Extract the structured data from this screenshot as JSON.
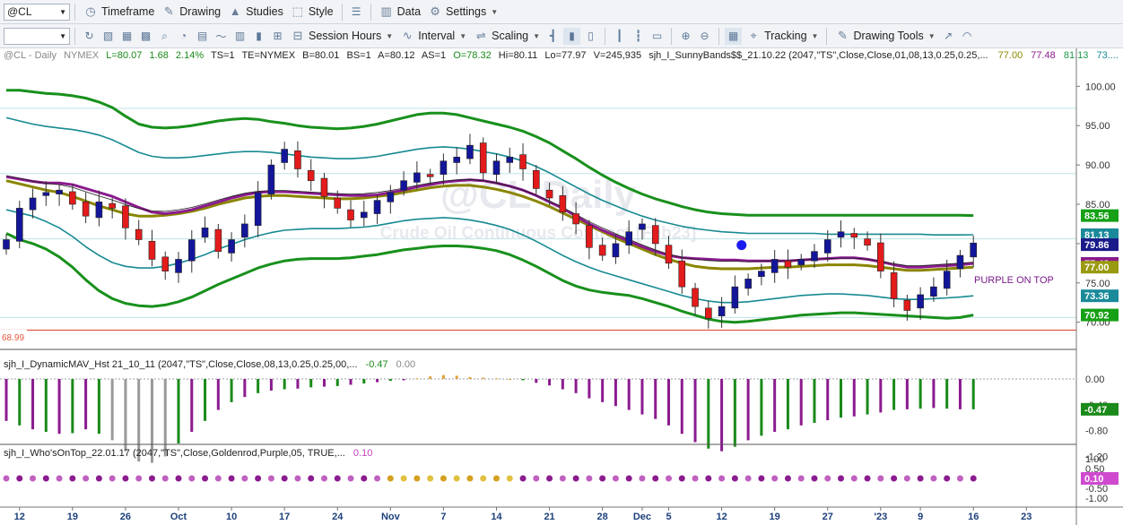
{
  "toolbar1": {
    "symbol": "@CL",
    "items": [
      {
        "label": "Timeframe",
        "icon": "timeframe-icon"
      },
      {
        "label": "Drawing",
        "icon": "pencil-icon"
      },
      {
        "label": "Studies",
        "icon": "studies-icon"
      },
      {
        "label": "Style",
        "icon": "style-icon"
      },
      {
        "label": "Data",
        "icon": "data-icon"
      },
      {
        "label": "Settings",
        "icon": "gear-icon"
      }
    ]
  },
  "toolbar2": {
    "input_value": "",
    "items": [
      {
        "label": "Session Hours"
      },
      {
        "label": "Interval"
      },
      {
        "label": "Scaling"
      },
      {
        "label": "Tracking"
      },
      {
        "label": "Drawing Tools"
      }
    ]
  },
  "header": {
    "prefix": "@CL - Daily",
    "exchange": "NYMEX",
    "last": "L=80.07",
    "change": "1.68",
    "pct": "2.14%",
    "ts": "TS=1",
    "te": "TE=NYMEX",
    "bid": "B=80.01",
    "bs": "BS=1",
    "ask": "A=80.12",
    "as": "AS=1",
    "open": "O=78.32",
    "high": "Hi=80.11",
    "low": "Lo=77.97",
    "volume": "V=245,935",
    "study": "sjh_I_SunnyBands$$_21.10.22 (2047,\"TS\",Close,Close,01,08,13,0.25,0.25,...",
    "values": [
      {
        "text": "77.00",
        "color": "#8a8a00"
      },
      {
        "text": "77.48",
        "color": "#8a1a8a"
      },
      {
        "text": "81.13",
        "color": "#1a9a4a"
      },
      {
        "text": "73....",
        "color": "#1a8a9a"
      }
    ]
  },
  "watermark": {
    "title": "@CL Daily",
    "subtitle": "Crude Oil Continuous Contract [Feb23]"
  },
  "annotation": {
    "text": "PURPLE ON TOP",
    "color": "#7a1a8a"
  },
  "price_line": {
    "value": 68.99,
    "label": "68.99",
    "color": "#e2593f"
  },
  "h_lines": [
    97.2,
    88.9,
    80.6,
    70.6
  ],
  "dot": {
    "x": 55.5,
    "y": 79.8,
    "color": "#1b1bf0"
  },
  "panel2": {
    "title": "sjh_I_DynamicMAV_Hst 21_10_11 (2047,\"TS\",Close,Close,08,13,0.25,0.25,00,...",
    "values": [
      {
        "text": "-0.47",
        "color": "#1a8a1a"
      },
      {
        "text": "0.00",
        "color": "#888888"
      }
    ],
    "ticks": [
      "0.00",
      "-0.40",
      "-0.80",
      "-1.20"
    ],
    "last_label": "-0.47"
  },
  "panel3": {
    "title": "sjh_I_Who'sOnTop_22.01.17 (2047,\"TS\",Close,Goldenrod,Purple,05, TRUE,...",
    "value": {
      "text": "0.10",
      "color": "#c23fbf"
    },
    "ticks": [
      "1.00",
      "0.50",
      "-0.50",
      "-1.00"
    ],
    "last_label": "0.10"
  },
  "chart_data": {
    "type": "candlestick",
    "ylim": [
      67,
      103
    ],
    "y_ticks": [
      100,
      95,
      90,
      85,
      80,
      75,
      70
    ],
    "x_ticks": [
      {
        "i": 1,
        "label": "12"
      },
      {
        "i": 5,
        "label": "19"
      },
      {
        "i": 9,
        "label": "26"
      },
      {
        "i": 13,
        "label": "Oct"
      },
      {
        "i": 17,
        "label": "10"
      },
      {
        "i": 21,
        "label": "17"
      },
      {
        "i": 25,
        "label": "24"
      },
      {
        "i": 29,
        "label": "Nov"
      },
      {
        "i": 33,
        "label": "7"
      },
      {
        "i": 37,
        "label": "14"
      },
      {
        "i": 41,
        "label": "21"
      },
      {
        "i": 45,
        "label": "28"
      },
      {
        "i": 48,
        "label": "Dec"
      },
      {
        "i": 50,
        "label": "5"
      },
      {
        "i": 54,
        "label": "12"
      },
      {
        "i": 58,
        "label": "19"
      },
      {
        "i": 62,
        "label": "27"
      },
      {
        "i": 66,
        "label": "'23"
      },
      {
        "i": 69,
        "label": "9"
      },
      {
        "i": 73,
        "label": "16"
      },
      {
        "i": 77,
        "label": "23"
      }
    ],
    "right_labels": [
      {
        "v": 83.56,
        "text": "83.56",
        "color": "#15a015"
      },
      {
        "v": 81.13,
        "text": "81.13",
        "color": "#1a8a9a"
      },
      {
        "v": 79.86,
        "text": "79.86",
        "color": "#1a1a8a"
      },
      {
        "v": 77.48,
        "text": "77.48",
        "color": "#8a1a8a"
      },
      {
        "v": 77.0,
        "text": "77.00",
        "color": "#9a9a10"
      },
      {
        "v": 73.36,
        "text": "73.36",
        "color": "#1a8a9a"
      },
      {
        "v": 70.92,
        "text": "70.92",
        "color": "#15a015"
      }
    ],
    "closes": [
      80.5,
      84.5,
      85.8,
      86.5,
      86.8,
      85.0,
      83.5,
      85.3,
      84.5,
      82.0,
      80.5,
      78.0,
      76.5,
      78.0,
      80.5,
      82.0,
      79.0,
      80.5,
      82.5,
      86.5,
      90.0,
      92.0,
      89.5,
      88.0,
      86.0,
      84.5,
      83.0,
      84.0,
      85.5,
      86.5,
      88.0,
      89.0,
      88.5,
      90.5,
      91.0,
      92.5,
      89.0,
      90.5,
      91.0,
      89.5,
      87.0,
      85.8,
      84.0,
      82.5,
      79.5,
      78.5,
      80.0,
      81.5,
      82.5,
      80.0,
      77.5,
      74.5,
      72.0,
      70.5,
      72.0,
      74.5,
      75.5,
      76.5,
      78.0,
      77.0,
      78.0,
      79.0,
      80.5,
      81.5,
      80.8,
      79.8,
      76.5,
      73.0,
      71.5,
      73.5,
      74.5,
      76.5,
      78.5,
      80.07
    ],
    "ma_purple": [
      88.5,
      88.2,
      87.9,
      87.7,
      87.7,
      87.5,
      87.0,
      86.5,
      86.0,
      85.3,
      84.6,
      84.0,
      83.8,
      84.0,
      84.3,
      84.8,
      85.3,
      85.8,
      86.2,
      86.5,
      86.6,
      86.6,
      86.5,
      86.4,
      86.3,
      86.2,
      86.1,
      86.1,
      86.2,
      86.5,
      86.8,
      87.2,
      87.5,
      87.8,
      88.0,
      88.1,
      88.0,
      87.7,
      87.3,
      86.8,
      86.1,
      85.3,
      84.5,
      83.5,
      82.5,
      81.7,
      81.0,
      80.3,
      79.6,
      79.0,
      78.5,
      78.2,
      78.1,
      78.0,
      77.9,
      77.9,
      77.8,
      77.8,
      77.8,
      77.8,
      77.9,
      78.0,
      78.1,
      78.2,
      78.2,
      78.0,
      77.7,
      77.3,
      77.0,
      77.0,
      77.1,
      77.2,
      77.3,
      77.48
    ],
    "ma_olive": [
      88.0,
      87.6,
      87.2,
      86.8,
      86.5,
      86.0,
      85.4,
      84.8,
      84.3,
      83.8,
      83.5,
      83.5,
      83.6,
      83.8,
      84.1,
      84.5,
      85.0,
      85.4,
      85.8,
      86.0,
      86.1,
      86.1,
      86.0,
      85.9,
      85.8,
      85.7,
      85.7,
      85.8,
      86.0,
      86.2,
      86.5,
      86.8,
      87.1,
      87.3,
      87.4,
      87.4,
      87.2,
      86.9,
      86.5,
      86.0,
      85.4,
      84.7,
      83.9,
      83.1,
      82.3,
      81.5,
      80.7,
      80.0,
      79.3,
      78.6,
      78.0,
      77.5,
      77.1,
      76.9,
      76.8,
      76.8,
      76.8,
      76.9,
      77.0,
      77.0,
      77.1,
      77.2,
      77.3,
      77.3,
      77.3,
      77.2,
      77.0,
      76.8,
      76.6,
      76.6,
      76.7,
      76.8,
      76.9,
      77.0
    ],
    "band_outer_up": [
      99.5,
      99.5,
      99.3,
      99.1,
      99.0,
      98.8,
      98.5,
      98.0,
      97.3,
      96.2,
      95.2,
      94.8,
      94.7,
      94.8,
      95.0,
      95.3,
      95.6,
      95.8,
      95.9,
      95.8,
      95.5,
      95.3,
      95.0,
      94.8,
      94.7,
      94.6,
      94.7,
      94.9,
      95.2,
      95.6,
      96.0,
      96.4,
      96.6,
      96.6,
      96.4,
      96.0,
      95.6,
      95.2,
      94.8,
      94.3,
      93.6,
      92.8,
      91.8,
      90.8,
      89.7,
      88.7,
      87.8,
      87.0,
      86.3,
      85.7,
      85.2,
      84.7,
      84.3,
      84.0,
      83.8,
      83.7,
      83.6,
      83.6,
      83.6,
      83.6,
      83.6,
      83.6,
      83.6,
      83.6,
      83.6,
      83.6,
      83.6,
      83.6,
      83.6,
      83.6,
      83.6,
      83.6,
      83.6,
      83.56
    ],
    "band_outer_lo": [
      81.3,
      80.5,
      80.0,
      79.3,
      78.3,
      77.0,
      75.4,
      74.0,
      73.0,
      72.4,
      72.1,
      72.0,
      72.2,
      72.6,
      73.2,
      74.0,
      74.8,
      75.5,
      76.2,
      76.9,
      77.4,
      77.8,
      78.0,
      78.1,
      78.1,
      78.1,
      78.2,
      78.4,
      78.6,
      78.9,
      79.2,
      79.4,
      79.6,
      79.7,
      79.7,
      79.6,
      79.4,
      79.1,
      78.6,
      77.9,
      77.1,
      76.2,
      75.3,
      74.6,
      74.1,
      73.8,
      73.6,
      73.4,
      73.0,
      72.5,
      72.0,
      71.4,
      70.9,
      70.4,
      70.1,
      70.0,
      70.1,
      70.3,
      70.5,
      70.7,
      70.9,
      71.0,
      71.1,
      71.2,
      71.2,
      71.1,
      71.0,
      70.9,
      70.8,
      70.7,
      70.6,
      70.5,
      70.6,
      70.92
    ],
    "band_inner_up": [
      96.0,
      95.6,
      95.2,
      94.9,
      94.7,
      94.5,
      94.2,
      93.8,
      93.2,
      92.4,
      91.6,
      91.1,
      90.9,
      90.9,
      91.0,
      91.2,
      91.4,
      91.6,
      91.7,
      91.7,
      91.6,
      91.4,
      91.2,
      91.0,
      90.9,
      90.8,
      90.8,
      90.9,
      91.1,
      91.4,
      91.7,
      92.0,
      92.2,
      92.3,
      92.2,
      92.0,
      91.7,
      91.4,
      91.0,
      90.5,
      89.8,
      89.0,
      88.1,
      87.2,
      86.3,
      85.5,
      84.8,
      84.1,
      83.5,
      83.0,
      82.6,
      82.2,
      81.9,
      81.7,
      81.5,
      81.4,
      81.3,
      81.3,
      81.3,
      81.3,
      81.3,
      81.3,
      81.2,
      81.2,
      81.2,
      81.2,
      81.2,
      81.2,
      81.2,
      81.2,
      81.1,
      81.1,
      81.1,
      81.13
    ],
    "band_inner_lo": [
      84.3,
      83.9,
      83.5,
      82.8,
      82.0,
      80.9,
      79.6,
      78.5,
      77.6,
      77.1,
      76.9,
      76.9,
      77.1,
      77.5,
      78.0,
      78.6,
      79.3,
      79.9,
      80.5,
      81.0,
      81.4,
      81.7,
      81.8,
      81.9,
      81.9,
      81.9,
      82.0,
      82.1,
      82.3,
      82.6,
      82.9,
      83.1,
      83.2,
      83.3,
      83.2,
      83.0,
      82.7,
      82.3,
      81.8,
      81.1,
      80.3,
      79.4,
      78.5,
      77.7,
      77.0,
      76.4,
      75.9,
      75.4,
      74.9,
      74.4,
      73.9,
      73.4,
      73.0,
      72.7,
      72.5,
      72.5,
      72.6,
      72.8,
      73.0,
      73.2,
      73.4,
      73.5,
      73.6,
      73.6,
      73.5,
      73.4,
      73.2,
      73.0,
      72.9,
      72.9,
      73.0,
      73.1,
      73.2,
      73.36
    ],
    "histogram": [
      -0.65,
      -0.72,
      -0.78,
      -0.82,
      -0.85,
      -0.84,
      -0.78,
      -0.85,
      -0.95,
      -1.12,
      -1.28,
      -1.3,
      -1.2,
      -1.0,
      -0.82,
      -0.65,
      -0.48,
      -0.36,
      -0.28,
      -0.22,
      -0.18,
      -0.16,
      -0.15,
      -0.13,
      -0.12,
      -0.11,
      -0.09,
      -0.07,
      -0.05,
      -0.03,
      -0.02,
      0.01,
      0.04,
      0.06,
      0.05,
      0.03,
      0.02,
      0.01,
      0.0,
      -0.02,
      -0.06,
      -0.1,
      -0.16,
      -0.22,
      -0.3,
      -0.36,
      -0.42,
      -0.48,
      -0.55,
      -0.62,
      -0.72,
      -0.85,
      -0.98,
      -1.08,
      -1.12,
      -1.05,
      -0.95,
      -0.88,
      -0.82,
      -0.78,
      -0.72,
      -0.68,
      -0.64,
      -0.6,
      -0.58,
      -0.55,
      -0.52,
      -0.48,
      -0.47,
      -0.46,
      -0.45,
      -0.46,
      -0.47,
      -0.47
    ],
    "who_on_top": [
      1,
      1,
      1,
      1,
      1,
      1,
      1,
      1,
      1,
      1,
      1,
      1,
      1,
      1,
      1,
      1,
      1,
      1,
      1,
      1,
      1,
      1,
      1,
      1,
      1,
      1,
      1,
      1,
      1,
      0,
      0,
      0,
      0,
      0,
      0,
      0,
      0,
      0,
      0,
      1,
      1,
      1,
      1,
      1,
      1,
      1,
      1,
      1,
      1,
      1,
      1,
      1,
      1,
      1,
      1,
      1,
      1,
      1,
      1,
      1,
      1,
      1,
      1,
      1,
      1,
      1,
      1,
      1,
      1,
      1,
      1,
      1,
      1,
      1
    ]
  }
}
